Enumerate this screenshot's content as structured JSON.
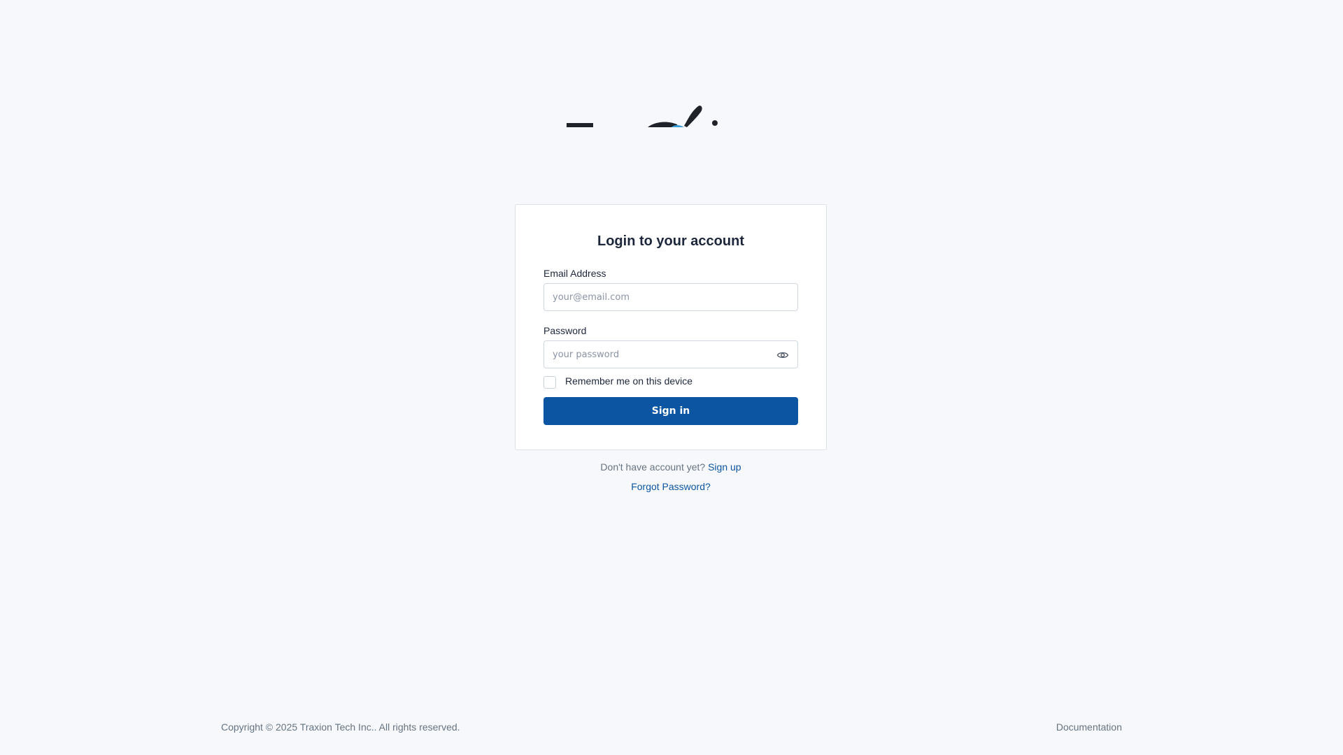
{
  "login": {
    "title": "Login to your account",
    "email_label": "Email Address",
    "email_placeholder": "your@email.com",
    "email_value": "",
    "password_label": "Password",
    "password_placeholder": "your password",
    "password_value": "",
    "remember_label": "Remember me on this device",
    "remember_checked": false,
    "signin_label": "Sign in"
  },
  "links": {
    "signup_prompt": "Don't have account yet?",
    "signup_label": "Sign up",
    "forgot_label": "Forgot Password?"
  },
  "footer": {
    "copyright": "Copyright © 2025 Traxion Tech Inc.. All rights reserved.",
    "documentation": "Documentation"
  },
  "icons": {
    "password_toggle": "eye-icon",
    "logo": "brand-logo"
  },
  "colors": {
    "background": "#f6f8fb",
    "primary": "#0b55a3",
    "text": "#1d273b",
    "muted": "#667382",
    "logo_dark": "#1f2228",
    "logo_accent": "#3a9fd8"
  }
}
